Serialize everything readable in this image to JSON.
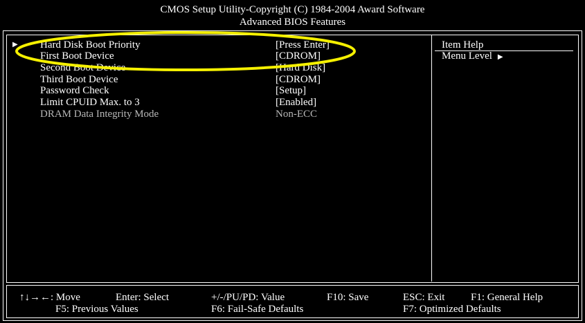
{
  "header": {
    "title": "CMOS Setup Utility-Copyright (C) 1984-2004 Award Software",
    "subtitle": "Advanced BIOS Features"
  },
  "items": [
    {
      "label": "Hard Disk Boot Priority",
      "value": "[Press Enter]",
      "submenu": true
    },
    {
      "label": "First Boot Device",
      "value": "[CDROM]"
    },
    {
      "label": "Second Boot Device",
      "value": "[Hard Disk]"
    },
    {
      "label": "Third Boot Device",
      "value": "[CDROM]"
    },
    {
      "label": "Password Check",
      "value": "[Setup]"
    },
    {
      "label": "Limit CPUID Max. to 3",
      "value": "[Enabled]"
    },
    {
      "label": "DRAM Data Integrity Mode",
      "value": "Non-ECC",
      "disabled": true
    }
  ],
  "help": {
    "title": "Item Help",
    "menu_level": "Menu Level"
  },
  "footer": {
    "move": "↑↓→←: Move",
    "enter": "Enter: Select",
    "value": "+/-/PU/PD: Value",
    "save": "F10: Save",
    "exit": "ESC: Exit",
    "general_help": "F1: General Help",
    "previous": "F5: Previous Values",
    "failsafe": "F6: Fail-Safe Defaults",
    "optimized": "F7: Optimized Defaults"
  },
  "colors": {
    "background": "#000000",
    "text": "#ffffff",
    "disabled": "#b8b8b8",
    "highlight": "#f5f000"
  }
}
